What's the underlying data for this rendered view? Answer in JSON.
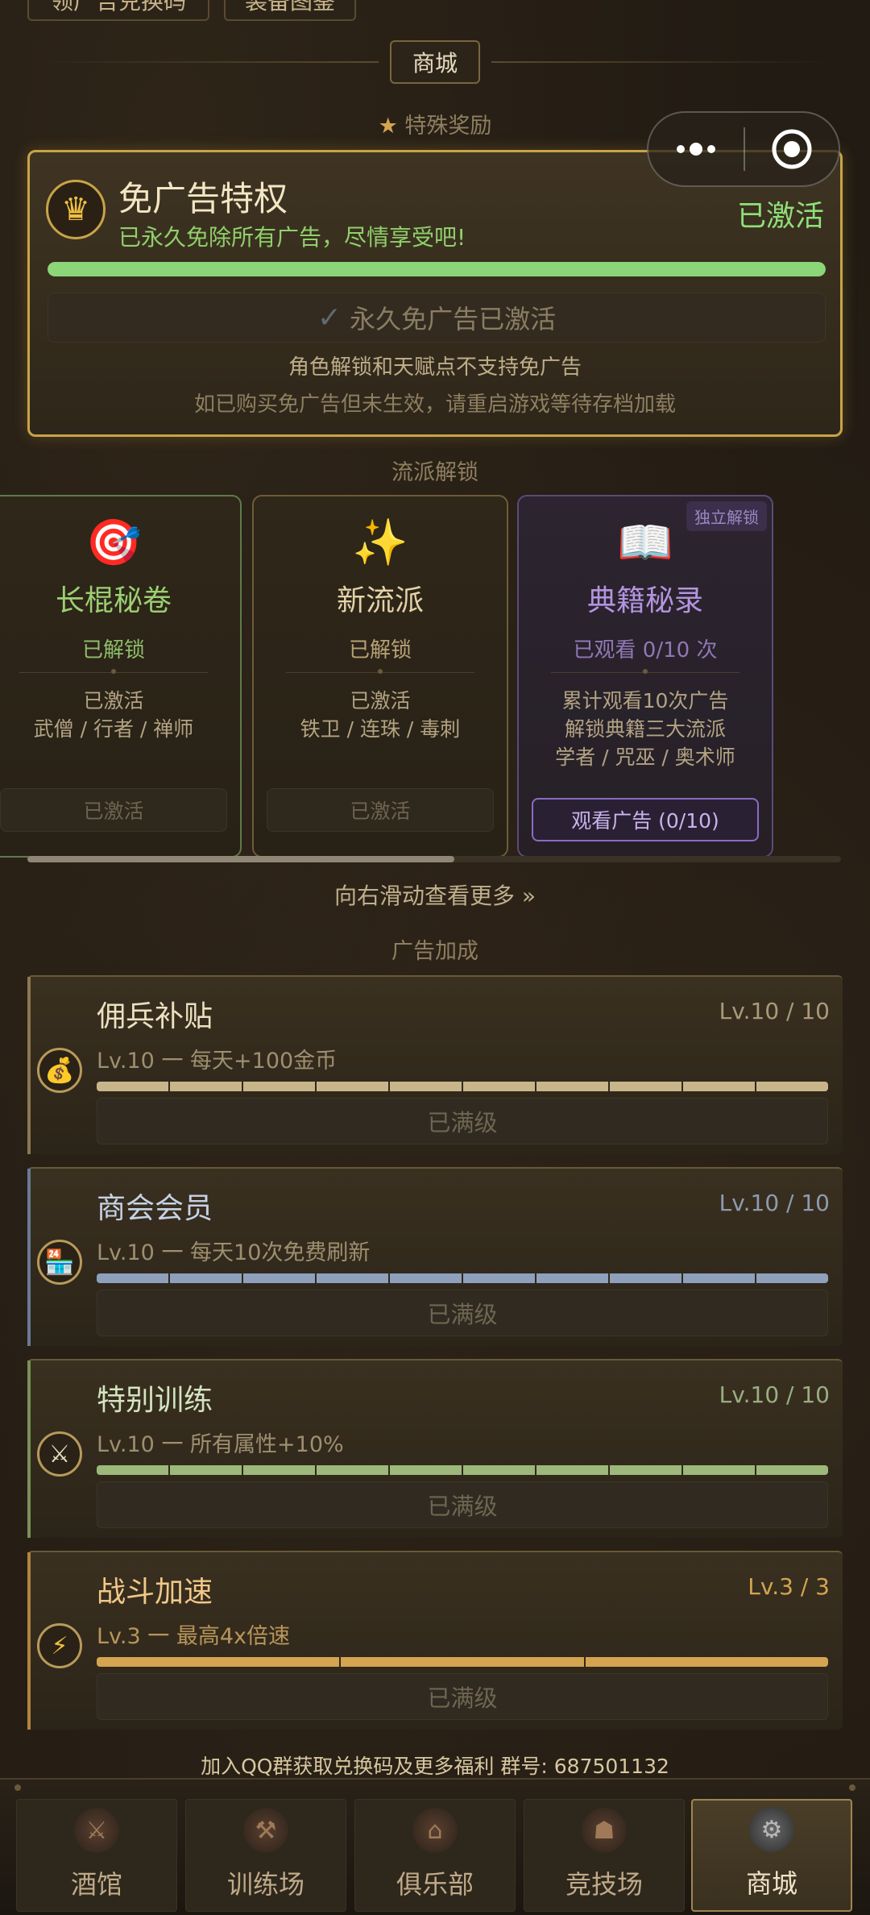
{
  "top_tabs": [
    "领广告兑换码",
    "装备图鉴"
  ],
  "header": {
    "shop_title": "商城",
    "special_reward": "特殊奖励",
    "school_unlock": "流派解锁",
    "ad_bonus": "广告加成"
  },
  "privilege": {
    "title": "免广告特权",
    "subtitle": "已永久免除所有广告，尽情享受吧!",
    "status": "已激活",
    "progress": 1.0,
    "button_label": "永久免广告已激活",
    "note1": "角色解锁和天赋点不支持免广告",
    "note2": "如已购买免广告但未生效，请重启游戏等待存档加载"
  },
  "schools": [
    {
      "icon": "🎯",
      "name": "长棍秘卷",
      "state": "已解锁",
      "desc1": "已激活",
      "desc2": "武僧 / 行者 / 禅师",
      "button": "已激活"
    },
    {
      "icon": "✨",
      "name": "新流派",
      "state": "已解锁",
      "desc1": "已激活",
      "desc2": "铁卫 / 连珠 / 毒刺",
      "button": "已激活"
    },
    {
      "icon": "📖",
      "name": "典籍秘录",
      "state": "已观看 0/10 次",
      "badge": "独立解锁",
      "desc1": "累计观看10次广告",
      "desc2": "解锁典籍三大流派",
      "desc3": "学者 / 咒巫 / 奥术师",
      "button": "观看广告 (0/10)"
    }
  ],
  "more_hint": "向右滑动查看更多 »",
  "upgrades": [
    {
      "icon": "💰",
      "title": "佣兵补贴",
      "level": "Lv.10 / 10",
      "desc": "Lv.10 一 每天+100金币",
      "segments": 10,
      "filled": 10,
      "color": "#c8b68a",
      "button": "已满级"
    },
    {
      "icon": "🏪",
      "title": "商会会员",
      "level": "Lv.10 / 10",
      "desc": "Lv.10 一 每天10次免费刷新",
      "segments": 10,
      "filled": 10,
      "color": "#8ea0bc",
      "button": "已满级"
    },
    {
      "icon": "⚔",
      "title": "特别训练",
      "level": "Lv.10 / 10",
      "desc": "Lv.10 一 所有属性+10%",
      "segments": 10,
      "filled": 10,
      "color": "#9cb87a",
      "button": "已满级"
    },
    {
      "icon": "⚡",
      "title": "战斗加速",
      "level": "Lv.3 / 3",
      "desc": "Lv.3 一 最高4x倍速",
      "segments": 3,
      "filled": 3,
      "color": "#d4a450",
      "button": "已满级"
    }
  ],
  "footer_note": "加入QQ群获取兑换码及更多福利  群号: 687501132",
  "nav": [
    "酒馆",
    "训练场",
    "俱乐部",
    "竞技场",
    "商城"
  ],
  "colors": {
    "gold": "#c8a448",
    "green": "#8fe07a",
    "purple": "#a98ad0"
  }
}
